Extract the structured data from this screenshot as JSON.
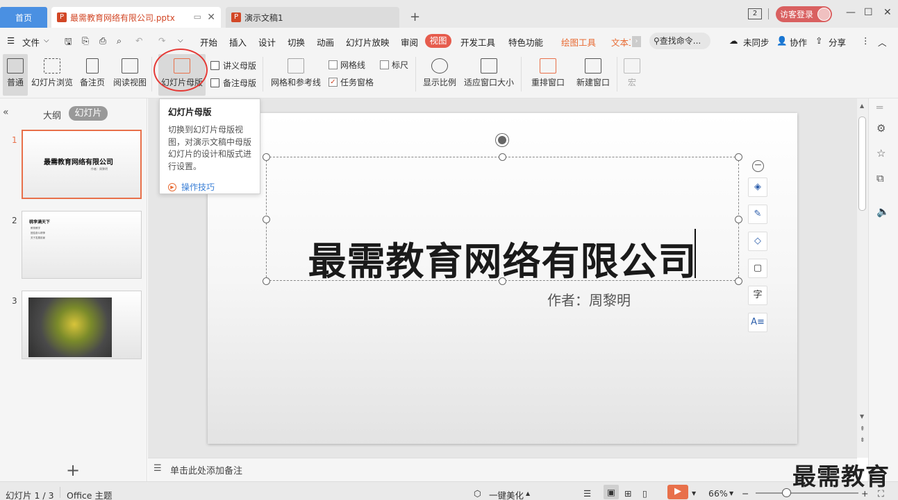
{
  "tabs": {
    "home": "首页",
    "active_doc": "最需教育网络有限公司.pptx",
    "doc2": "演示文稿1",
    "new_tab": "+"
  },
  "titlebar": {
    "window_count": "2",
    "login": "访客登录"
  },
  "menu": {
    "file": "文件",
    "items": [
      "开始",
      "插入",
      "设计",
      "切换",
      "动画",
      "幻灯片放映",
      "审阅",
      "视图",
      "开发工具",
      "特色功能",
      "绘图工具",
      "文本工"
    ],
    "search": "查找命令...",
    "sync": "未同步",
    "collab": "协作",
    "share": "分享"
  },
  "ribbon": {
    "normal": "普通",
    "sorter": "幻灯片浏览",
    "notes_page": "备注页",
    "reading": "阅读视图",
    "slide_master": "幻灯片母版",
    "handout_master": "讲义母版",
    "notes_master": "备注母版",
    "grid_guides": "网格和参考线",
    "gridlines": "网格线",
    "ruler": "标尺",
    "task_pane": "任务窗格",
    "zoom": "显示比例",
    "fit_window": "适应窗口大小",
    "arrange": "重排窗口",
    "new_window": "新建窗口",
    "macro": "宏"
  },
  "tooltip": {
    "title": "幻灯片母版",
    "body": "切换到幻灯片母版视图，对演示文稿中母版幻灯片的设计和版式进行设置。",
    "link": "操作技巧"
  },
  "left_panel": {
    "outline": "大纲",
    "slides": "幻灯片",
    "thumbs": [
      {
        "num": "1",
        "title": "最需教育网络有限公司",
        "sub": "作者：周黎明"
      },
      {
        "num": "2",
        "title": "桃李满天下",
        "bullets": [
          "教育教学",
          "团结奋斗精神",
          "关于发展前景"
        ]
      },
      {
        "num": "3"
      }
    ]
  },
  "slide": {
    "title": "最需教育网络有限公司",
    "author": "作者：周黎明"
  },
  "notes": {
    "placeholder": "单击此处添加备注"
  },
  "status": {
    "slide_info": "幻灯片 1 / 3",
    "theme": "Office 主题",
    "beautify": "一键美化",
    "zoom": "66%"
  },
  "watermark": "最需教育"
}
